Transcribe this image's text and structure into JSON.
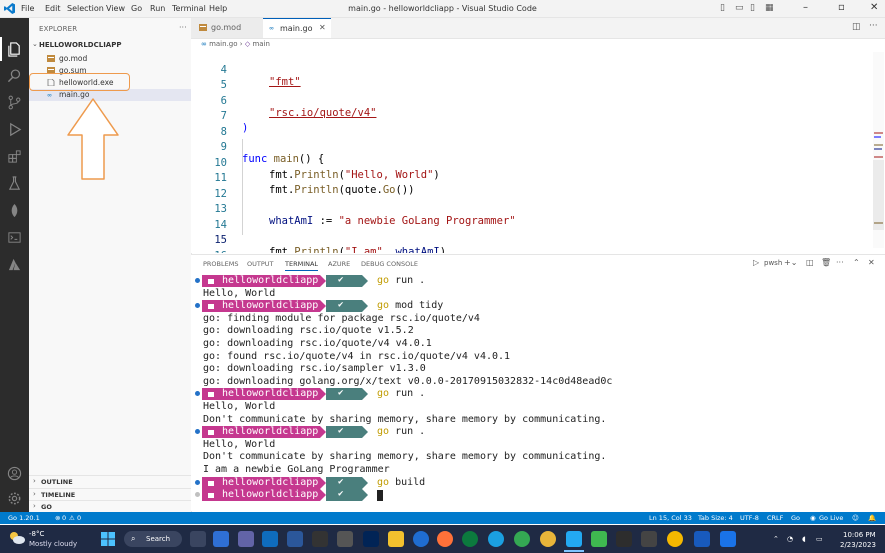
{
  "window": {
    "title": "main.go - helloworldcliapp - Visual Studio Code",
    "menu": [
      "File",
      "Edit",
      "Selection",
      "View",
      "Go",
      "Run",
      "Terminal",
      "Help"
    ]
  },
  "sidebar": {
    "title": "EXPLORER",
    "folder": "HELLOWORLDCLIAPP",
    "files": [
      {
        "name": "go.mod",
        "icon": "go-mod-icon"
      },
      {
        "name": "go.sum",
        "icon": "go-sum-icon"
      },
      {
        "name": "helloworld.exe",
        "icon": "file-icon"
      },
      {
        "name": "main.go",
        "icon": "go-file-icon"
      }
    ],
    "sections": [
      "OUTLINE",
      "TIMELINE",
      "GO"
    ]
  },
  "tabs": [
    {
      "label": "go.mod",
      "active": false
    },
    {
      "label": "main.go",
      "active": true
    }
  ],
  "breadcrumb": {
    "file": "main.go",
    "symbol": "main"
  },
  "editor": {
    "lines": [
      {
        "n": "4",
        "text": "\"fmt\""
      },
      {
        "n": "5",
        "text": ""
      },
      {
        "n": "6",
        "text": "\"rsc.io/quote/v4\""
      },
      {
        "n": "7",
        "text": ")"
      },
      {
        "n": "8",
        "text": ""
      },
      {
        "n": "9",
        "text": "func main() {"
      },
      {
        "n": "10",
        "text": "fmt.Println(\"Hello, World\")"
      },
      {
        "n": "11",
        "text": "fmt.Println(quote.Go())"
      },
      {
        "n": "12",
        "text": ""
      },
      {
        "n": "13",
        "text": "whatAmI := \"a newbie GoLang Programmer\""
      },
      {
        "n": "14",
        "text": ""
      },
      {
        "n": "15",
        "text": "fmt.Println(\"I am\", whatAmI)"
      },
      {
        "n": "16",
        "text": "}"
      }
    ]
  },
  "panel": {
    "tabs": [
      "PROBLEMS",
      "OUTPUT",
      "TERMINAL",
      "AZURE",
      "DEBUG CONSOLE"
    ],
    "active_tab": "TERMINAL",
    "shell": "pwsh"
  },
  "terminal": {
    "prompt_dir": "helloworldcliapp",
    "lines": [
      {
        "type": "prompt",
        "cmd": "go run ."
      },
      {
        "type": "out",
        "text": "Hello, World"
      },
      {
        "type": "prompt",
        "cmd": "go mod tidy"
      },
      {
        "type": "out",
        "text": "go: finding module for package rsc.io/quote/v4"
      },
      {
        "type": "out",
        "text": "go: downloading rsc.io/quote v1.5.2"
      },
      {
        "type": "out",
        "text": "go: downloading rsc.io/quote/v4 v4.0.1"
      },
      {
        "type": "out",
        "text": "go: found rsc.io/quote/v4 in rsc.io/quote/v4 v4.0.1"
      },
      {
        "type": "out",
        "text": "go: downloading rsc.io/sampler v1.3.0"
      },
      {
        "type": "out",
        "text": "go: downloading golang.org/x/text v0.0.0-20170915032832-14c0d48ead0c"
      },
      {
        "type": "prompt",
        "cmd": "go run ."
      },
      {
        "type": "out",
        "text": "Hello, World"
      },
      {
        "type": "out",
        "text": "Don't communicate by sharing memory, share memory by communicating."
      },
      {
        "type": "prompt",
        "cmd": "go run ."
      },
      {
        "type": "out",
        "text": "Hello, World"
      },
      {
        "type": "out",
        "text": "Don't communicate by sharing memory, share memory by communicating."
      },
      {
        "type": "out",
        "text": "I am a newbie GoLang Programmer"
      },
      {
        "type": "prompt",
        "cmd": "go build"
      },
      {
        "type": "prompt",
        "cmd": ""
      }
    ]
  },
  "status": {
    "left": [
      "Go 1.20.1",
      "0",
      "0"
    ],
    "right": [
      "Ln 15, Col 33",
      "Tab Size: 4",
      "UTF-8",
      "CRLF",
      "Go",
      "Go Live"
    ]
  },
  "taskbar": {
    "weather_temp": "-8°C",
    "weather_desc": "Mostly cloudy",
    "search": "Search",
    "time": "10:06 PM",
    "date": "2/23/2023"
  },
  "colors": {
    "statusbar": "#007acc",
    "prompt_pink": "#c5388f",
    "prompt_teal": "#4a7f7d",
    "highlight_orange": "#ee9a4d"
  }
}
